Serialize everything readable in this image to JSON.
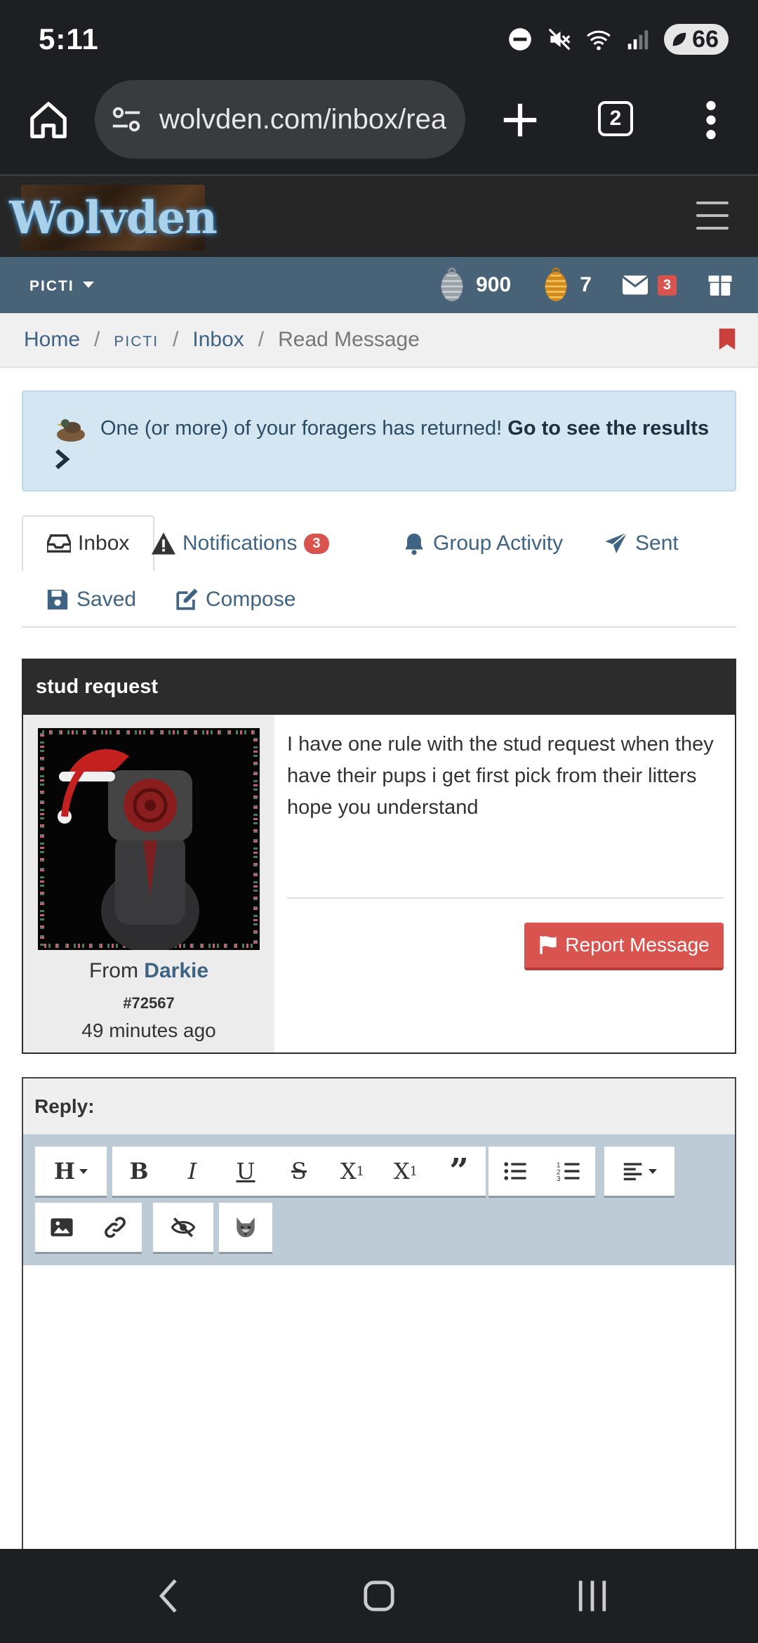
{
  "status": {
    "time": "5:11",
    "battery": "66"
  },
  "browser": {
    "url": "wolvden.com/inbox/rea",
    "tab_count": "2"
  },
  "site": {
    "logo_text": "Wolvden"
  },
  "userbar": {
    "username": "pιcτι",
    "currency_silver": "900",
    "currency_gold": "7",
    "mail_badge": "3"
  },
  "breadcrumb": {
    "home": "Home",
    "user": "pιcτι",
    "inbox": "Inbox",
    "current": "Read Message"
  },
  "alert": {
    "text": "One (or more) of your foragers has returned!",
    "link": "Go to see the results"
  },
  "tabs": {
    "inbox": "Inbox",
    "notifications": "Notifications",
    "notifications_badge": "3",
    "group_activity": "Group Activity",
    "sent": "Sent",
    "saved": "Saved",
    "compose": "Compose"
  },
  "message": {
    "subject": "stud request",
    "from_label": "From",
    "sender": "Darkie",
    "sender_id": "#72567",
    "time_ago": "49 minutes ago",
    "body": "I have one rule with the stud request when they have their pups i get first pick from their litters hope you understand",
    "report_label": "Report Message"
  },
  "reply": {
    "label": "Reply:",
    "toolbar": [
      "heading",
      "bold",
      "italic",
      "underline",
      "strikethrough",
      "superscript",
      "subscript",
      "quote",
      "bullet-list",
      "numbered-list",
      "align",
      "image",
      "link",
      "spoiler",
      "wolf-emoji"
    ]
  },
  "colors": {
    "userbar": "#486277",
    "link": "#3e6383",
    "danger": "#d9534f",
    "alert_bg": "#d4e6f1",
    "toolbar_bg": "#bccbd6"
  }
}
